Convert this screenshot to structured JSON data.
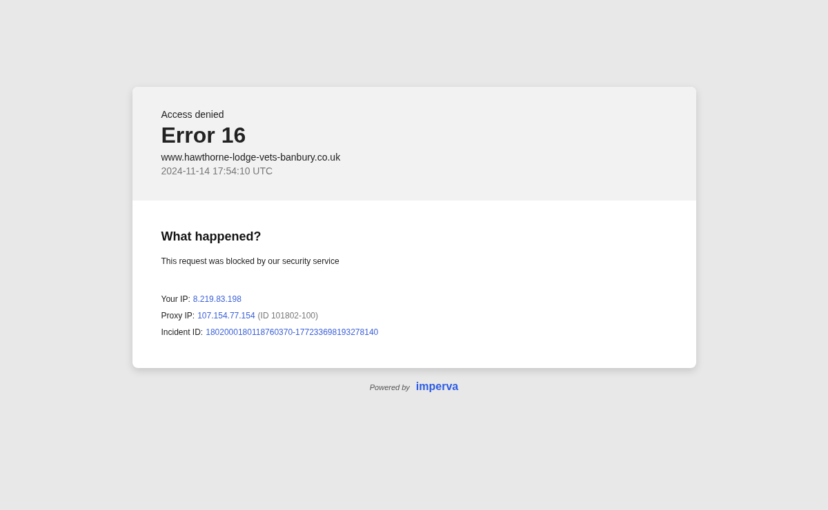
{
  "header": {
    "eyebrow": "Access denied",
    "title": "Error 16",
    "host": "www.hawthorne-lodge-vets-banbury.co.uk",
    "timestamp": "2024-11-14 17:54:10 UTC"
  },
  "body": {
    "heading": "What happened?",
    "message": "This request was blocked by our security service",
    "details": [
      {
        "label": "Your IP:",
        "value": "8.219.83.198"
      },
      {
        "label": "Proxy IP:",
        "value": "107.154.77.154",
        "note": "(ID 101802-100)"
      },
      {
        "label": "Incident ID:",
        "value": "1802000180118760370-177233698193278140"
      }
    ]
  },
  "footer": {
    "powered_by": "Powered by",
    "brand": "imperva"
  }
}
